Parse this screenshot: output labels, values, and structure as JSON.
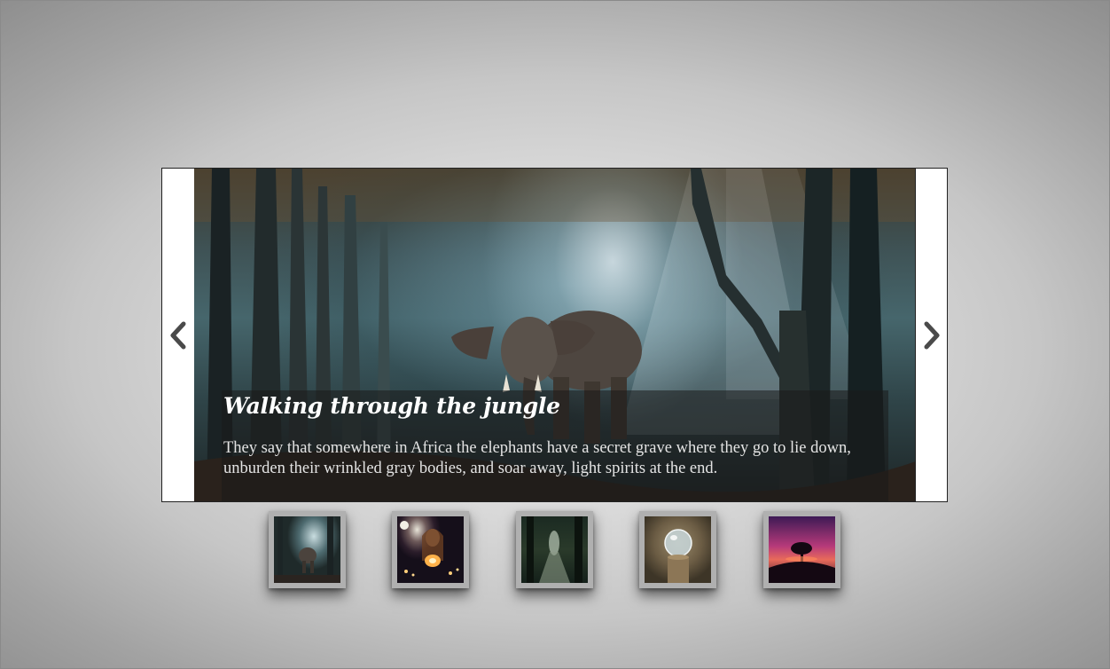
{
  "slider": {
    "prev_icon": "chevron-left-icon",
    "next_icon": "chevron-right-icon",
    "active_index": 0,
    "caption": {
      "title": "Walking through the jungle",
      "text": "They say that somewhere in Africa the elephants have a secret grave where they go to lie down, unburden their wrinkled gray bodies, and soar away, light spirits at the end."
    }
  },
  "thumbnails": [
    {
      "subject": "elephant in misty forest"
    },
    {
      "subject": "woman holding lights at night"
    },
    {
      "subject": "dark forest path"
    },
    {
      "subject": "crystal ball on stump"
    },
    {
      "subject": "tree at purple sunset"
    }
  ],
  "colors": {
    "caption_bg": "#191919",
    "caption_title": "#ffffff",
    "caption_text": "#e4e4e4",
    "thumb_frame": "#b0b0b0",
    "arrow": "#4a4a4a"
  }
}
